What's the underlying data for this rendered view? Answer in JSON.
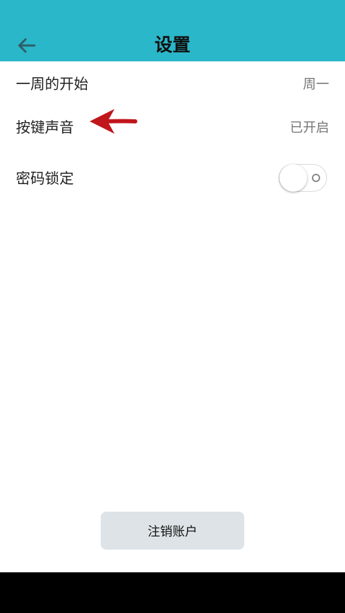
{
  "header": {
    "title": "设置",
    "back_icon": "arrow-left-icon",
    "background": "#2ab7c9"
  },
  "settings": {
    "week_start": {
      "label": "一周的开始",
      "value": "周一"
    },
    "key_sound": {
      "label": "按键声音",
      "value": "已开启"
    },
    "password_lock": {
      "label": "密码锁定",
      "enabled": false
    }
  },
  "annotation": {
    "icon": "red-arrow-left-icon",
    "color": "#c0161c"
  },
  "footer": {
    "logout_label": "注销账户"
  }
}
